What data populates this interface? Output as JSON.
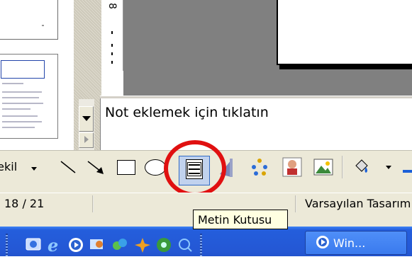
{
  "window": {
    "notes_placeholder": "Not eklemek için tıklatın",
    "ruler_label": "8"
  },
  "drawing_toolbar": {
    "draw_menu_label": "Şekil",
    "tooltip": "Metin Kutusu",
    "tools": [
      "line-icon",
      "arrow-icon",
      "rectangle-icon",
      "oval-icon",
      "text-box-icon",
      "vertical-text-box-icon",
      "diagram-icon",
      "clip-art-icon",
      "picture-icon",
      "fill-color-icon"
    ]
  },
  "status_bar": {
    "slide_counter": "18 / 21",
    "design_template": "Varsayılan Tasarım"
  },
  "taskbar": {
    "task_button_label": "Win...",
    "quick_launch": [
      "desktop-icon",
      "internet-explorer-icon",
      "media-player-icon",
      "messenger-icon",
      "msn-icon",
      "winamp-icon",
      "media-icon",
      "search-icon"
    ]
  },
  "colors": {
    "highlight_ring": "#e01010",
    "taskbar": "#245edc",
    "toolbar": "#ece9d8"
  }
}
